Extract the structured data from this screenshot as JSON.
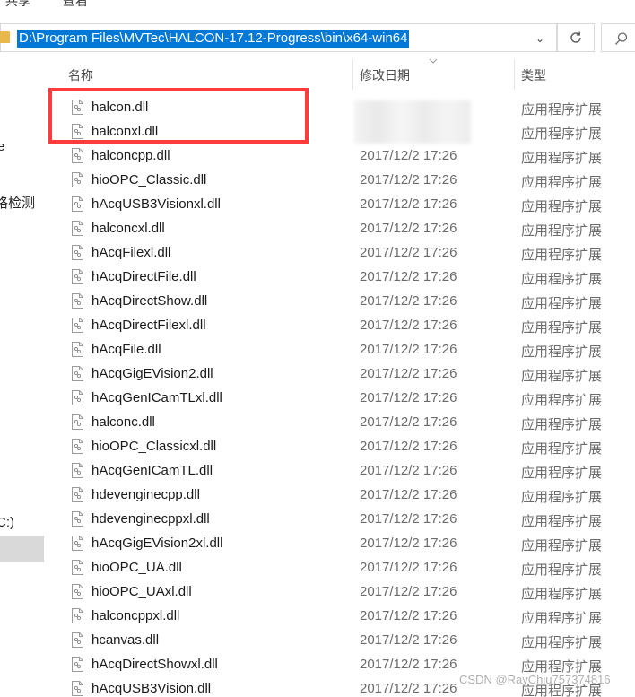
{
  "ribbon": {
    "tabs": [
      "共享",
      "查看"
    ]
  },
  "address_bar": {
    "path": "D:\\Program Files\\MVTec\\HALCON-17.12-Progress\\bin\\x64-win64"
  },
  "nav_pane": {
    "items": [
      "e",
      "格检测",
      "C:)"
    ]
  },
  "columns": {
    "name": "名称",
    "date": "修改日期",
    "type": "类型"
  },
  "files": [
    {
      "name": "halcon.dll",
      "date": "",
      "type": "应用程序扩展"
    },
    {
      "name": "halconxl.dll",
      "date": "",
      "type": "应用程序扩展"
    },
    {
      "name": "halconcpp.dll",
      "date": "2017/12/2 17:26",
      "type": "应用程序扩展"
    },
    {
      "name": "hioOPC_Classic.dll",
      "date": "2017/12/2 17:26",
      "type": "应用程序扩展"
    },
    {
      "name": "hAcqUSB3Visionxl.dll",
      "date": "2017/12/2 17:26",
      "type": "应用程序扩展"
    },
    {
      "name": "halconcxl.dll",
      "date": "2017/12/2 17:26",
      "type": "应用程序扩展"
    },
    {
      "name": "hAcqFilexl.dll",
      "date": "2017/12/2 17:26",
      "type": "应用程序扩展"
    },
    {
      "name": "hAcqDirectFile.dll",
      "date": "2017/12/2 17:26",
      "type": "应用程序扩展"
    },
    {
      "name": "hAcqDirectShow.dll",
      "date": "2017/12/2 17:26",
      "type": "应用程序扩展"
    },
    {
      "name": "hAcqDirectFilexl.dll",
      "date": "2017/12/2 17:26",
      "type": "应用程序扩展"
    },
    {
      "name": "hAcqFile.dll",
      "date": "2017/12/2 17:26",
      "type": "应用程序扩展"
    },
    {
      "name": "hAcqGigEVision2.dll",
      "date": "2017/12/2 17:26",
      "type": "应用程序扩展"
    },
    {
      "name": "hAcqGenICamTLxl.dll",
      "date": "2017/12/2 17:26",
      "type": "应用程序扩展"
    },
    {
      "name": "halconc.dll",
      "date": "2017/12/2 17:26",
      "type": "应用程序扩展"
    },
    {
      "name": "hioOPC_Classicxl.dll",
      "date": "2017/12/2 17:26",
      "type": "应用程序扩展"
    },
    {
      "name": "hAcqGenICamTL.dll",
      "date": "2017/12/2 17:26",
      "type": "应用程序扩展"
    },
    {
      "name": "hdevenginecpp.dll",
      "date": "2017/12/2 17:26",
      "type": "应用程序扩展"
    },
    {
      "name": "hdevenginecppxl.dll",
      "date": "2017/12/2 17:26",
      "type": "应用程序扩展"
    },
    {
      "name": "hAcqGigEVision2xl.dll",
      "date": "2017/12/2 17:26",
      "type": "应用程序扩展"
    },
    {
      "name": "hioOPC_UA.dll",
      "date": "2017/12/2 17:26",
      "type": "应用程序扩展"
    },
    {
      "name": "hioOPC_UAxl.dll",
      "date": "2017/12/2 17:26",
      "type": "应用程序扩展"
    },
    {
      "name": "halconcppxl.dll",
      "date": "2017/12/2 17:26",
      "type": "应用程序扩展"
    },
    {
      "name": "hcanvas.dll",
      "date": "2017/12/2 17:26",
      "type": "应用程序扩展"
    },
    {
      "name": "hAcqDirectShowxl.dll",
      "date": "2017/12/2 17:26",
      "type": "应用程序扩展"
    },
    {
      "name": "hAcqUSB3Vision.dll",
      "date": "2017/12/2 17:26",
      "type": "应用程序扩展"
    }
  ],
  "watermark": "CSDN @RayChiu757374816",
  "colors": {
    "selection": "#0078d7",
    "highlight_box": "#ff3b3b"
  }
}
